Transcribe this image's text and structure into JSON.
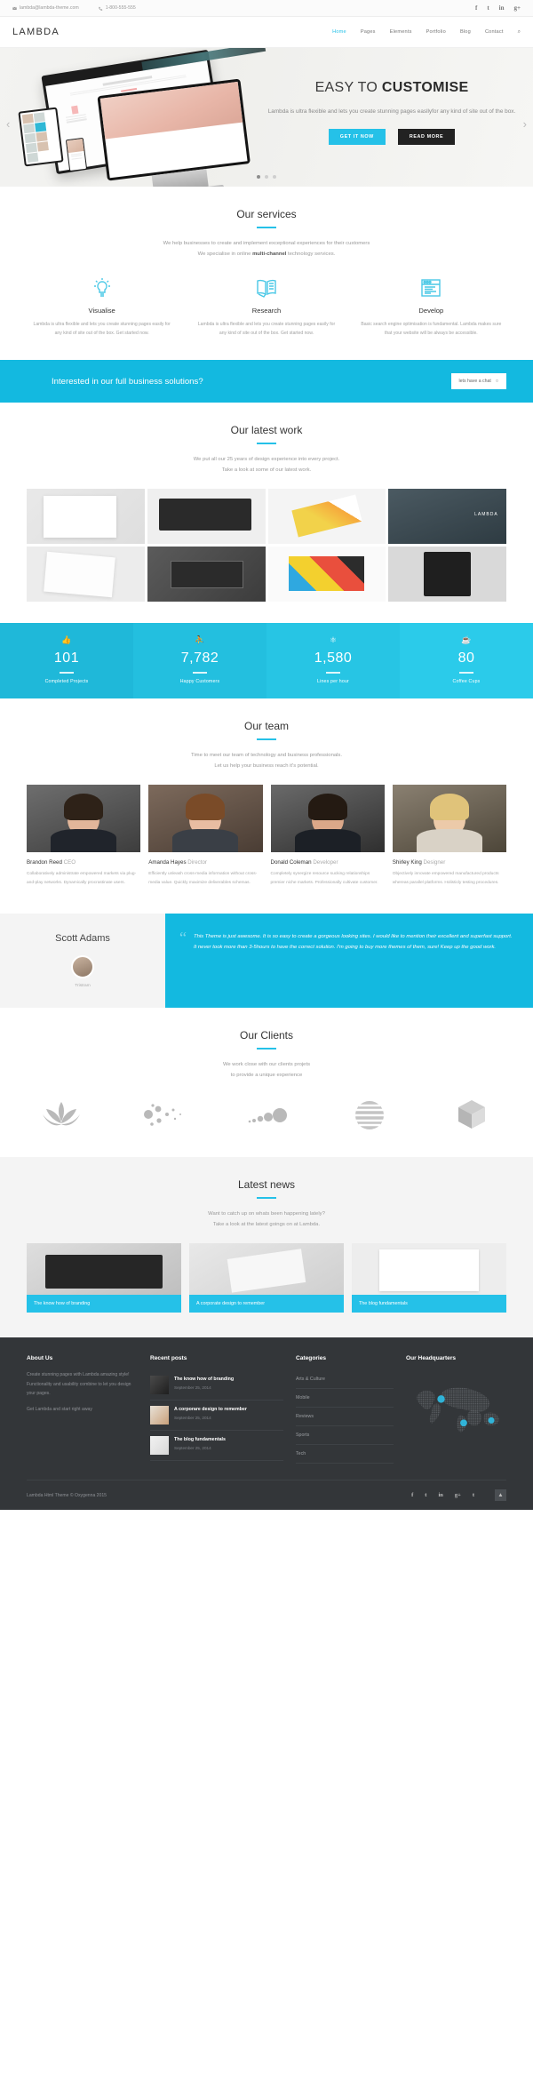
{
  "topbar": {
    "email": "lambda@lambda-theme.com",
    "phone": "1-800-555-555",
    "socials": [
      "f",
      "t",
      "in",
      "g+"
    ]
  },
  "nav": {
    "logo": "LAMBDA",
    "items": [
      {
        "label": "Home",
        "active": true
      },
      {
        "label": "Pages",
        "active": false
      },
      {
        "label": "Elements",
        "active": false
      },
      {
        "label": "Portfolio",
        "active": false
      },
      {
        "label": "Blog",
        "active": false
      },
      {
        "label": "Contact",
        "active": false
      }
    ],
    "search_icon": "search-icon"
  },
  "hero": {
    "title_light": "EASY TO",
    "title_bold": "CUSTOMISE",
    "paragraph": "Lambda is ultra flexible and lets you create stunning pages easllyfor any kind of site out of the box.",
    "btn_primary": "GET IT NOW",
    "btn_secondary": "READ MORE",
    "slides": 3,
    "active_slide": 1
  },
  "services": {
    "title": "Our services",
    "sub_line1": "We help businesses to create and implement exceptional experiences for their customers",
    "sub_line2_a": "We specialise in online ",
    "sub_line2_b": "multi-channel",
    "sub_line2_c": " technology services.",
    "cards": [
      {
        "icon": "lightbulb-icon",
        "title": "Visualise",
        "text": "Lambda is ultra flexible and lets you create stunning pages easily for any kind of site out of the box. Get started now."
      },
      {
        "icon": "book-research-icon",
        "title": "Research",
        "text": "Lambda is ultra flexible and lets you create stunning pages easily for any kind of site out of the box. Get started now."
      },
      {
        "icon": "browser-window-icon",
        "title": "Develop",
        "text": "Basic search engine optimisation is fundamental. Lambda makes sure that your website will be always be accessible."
      }
    ]
  },
  "cta": {
    "title": "Interested in our full business solutions?",
    "button": "lets have a chat",
    "button_icon": "chat-bubble-icon",
    "bg": "#13b9e0"
  },
  "work": {
    "title": "Our latest work",
    "sub_line1": "We put all our 25 years of design experience into every project.",
    "sub_line2": "Take a look at some of our latest work.",
    "items": [
      "stationery-mockup",
      "dark-tablet-mockup",
      "colorful-folder-mockup",
      "lambda-dark-brand",
      "paper-sheets-mockup",
      "dark-books-mockup",
      "color-blocks-mockup",
      "phone-dark-mockup"
    ]
  },
  "stats": [
    {
      "icon": "thumbs-up-icon",
      "value": "101",
      "label": "Completed Projects"
    },
    {
      "icon": "person-icon",
      "value": "7,782",
      "label": "Happy Customers"
    },
    {
      "icon": "dashboard-icon",
      "value": "1,580",
      "label": "Lines per hour"
    },
    {
      "icon": "coffee-cup-icon",
      "value": "80",
      "label": "Coffee Cups"
    }
  ],
  "team": {
    "title": "Our team",
    "sub_line1": "Time to meet our team of technology and business professionals.",
    "sub_line2": "Let us help your business reach it's potential.",
    "members": [
      {
        "name": "Brandon Reed",
        "role": "CEO",
        "text": "Collaboratively administrate empowered markets via plug-and-play networks. Dynamically procrastinate users."
      },
      {
        "name": "Amanda Hayes",
        "role": "Director",
        "text": "Efficiently unleash cross-media information without cross-media value. Quickly maximize deliverables schemas."
      },
      {
        "name": "Donald Coleman",
        "role": "Developer",
        "text": "Completely synergize resource sucking relationships premier niche markets. Professionally cultivate customer."
      },
      {
        "name": "Shirley King",
        "role": "Designer",
        "text": "Objectively innovate empowered manufactured products whereas parallel platforms. Holisticly testing procedures."
      }
    ]
  },
  "testimonial": {
    "name": "Scott Adams",
    "role": "Tristram",
    "quote_mark": "“",
    "text": "This Theme is just awesome. It is so easy to create a gorgeous looking sites. I would like to mention their excellent and superfast support. It never took more than 3-5hours to have the correct solution. I'm going to buy more themes of them, sure! Keep up the good work."
  },
  "clients": {
    "title": "Our Clients",
    "sub_line1": "We work close with our clients projets",
    "sub_line2": "to provide a unique experience",
    "logos": [
      "lotus-logo",
      "dots-cluster-logo",
      "circles-trail-logo",
      "striped-globe-logo",
      "facet-cube-logo"
    ]
  },
  "news": {
    "title": "Latest news",
    "sub_line1": "Want to catch up on whats been happening lately?",
    "sub_line2": "Take a look at the latest goings on at Lambda.",
    "posts": [
      {
        "thumb": "dark-tablet-thumb",
        "title": "The know how of branding"
      },
      {
        "thumb": "paper-design-thumb",
        "title": "A corporate design to remember"
      },
      {
        "thumb": "white-pages-thumb",
        "title": "The blog fundamentals"
      }
    ]
  },
  "footer": {
    "about": {
      "heading": "About Us",
      "p1": "Create stunning pages with Lambda amazing style! Functionality and usability combine to let you design your pages.",
      "p2": "Get Lambda and start right away"
    },
    "recent": {
      "heading": "Recent posts",
      "items": [
        {
          "title": "The know how of branding",
          "date": "September 25, 2014"
        },
        {
          "title": "A corporare design to remember",
          "date": "September 25, 2014"
        },
        {
          "title": "The blog fundamentals",
          "date": "September 25, 2014"
        }
      ]
    },
    "categories": {
      "heading": "Categories",
      "items": [
        "Arts & Culture",
        "Mobile",
        "Reviews",
        "Sports",
        "Tech"
      ]
    },
    "hq": {
      "heading": "Our Headquarters",
      "map_icon": "world-map-dots",
      "marker_color": "#2fc0e8"
    },
    "copyright": "Lambda Html Theme  © Oxygenna 2015",
    "socials": [
      "f",
      "t",
      "in",
      "g+",
      "t"
    ],
    "to_top_icon": "chevron-up-icon"
  }
}
